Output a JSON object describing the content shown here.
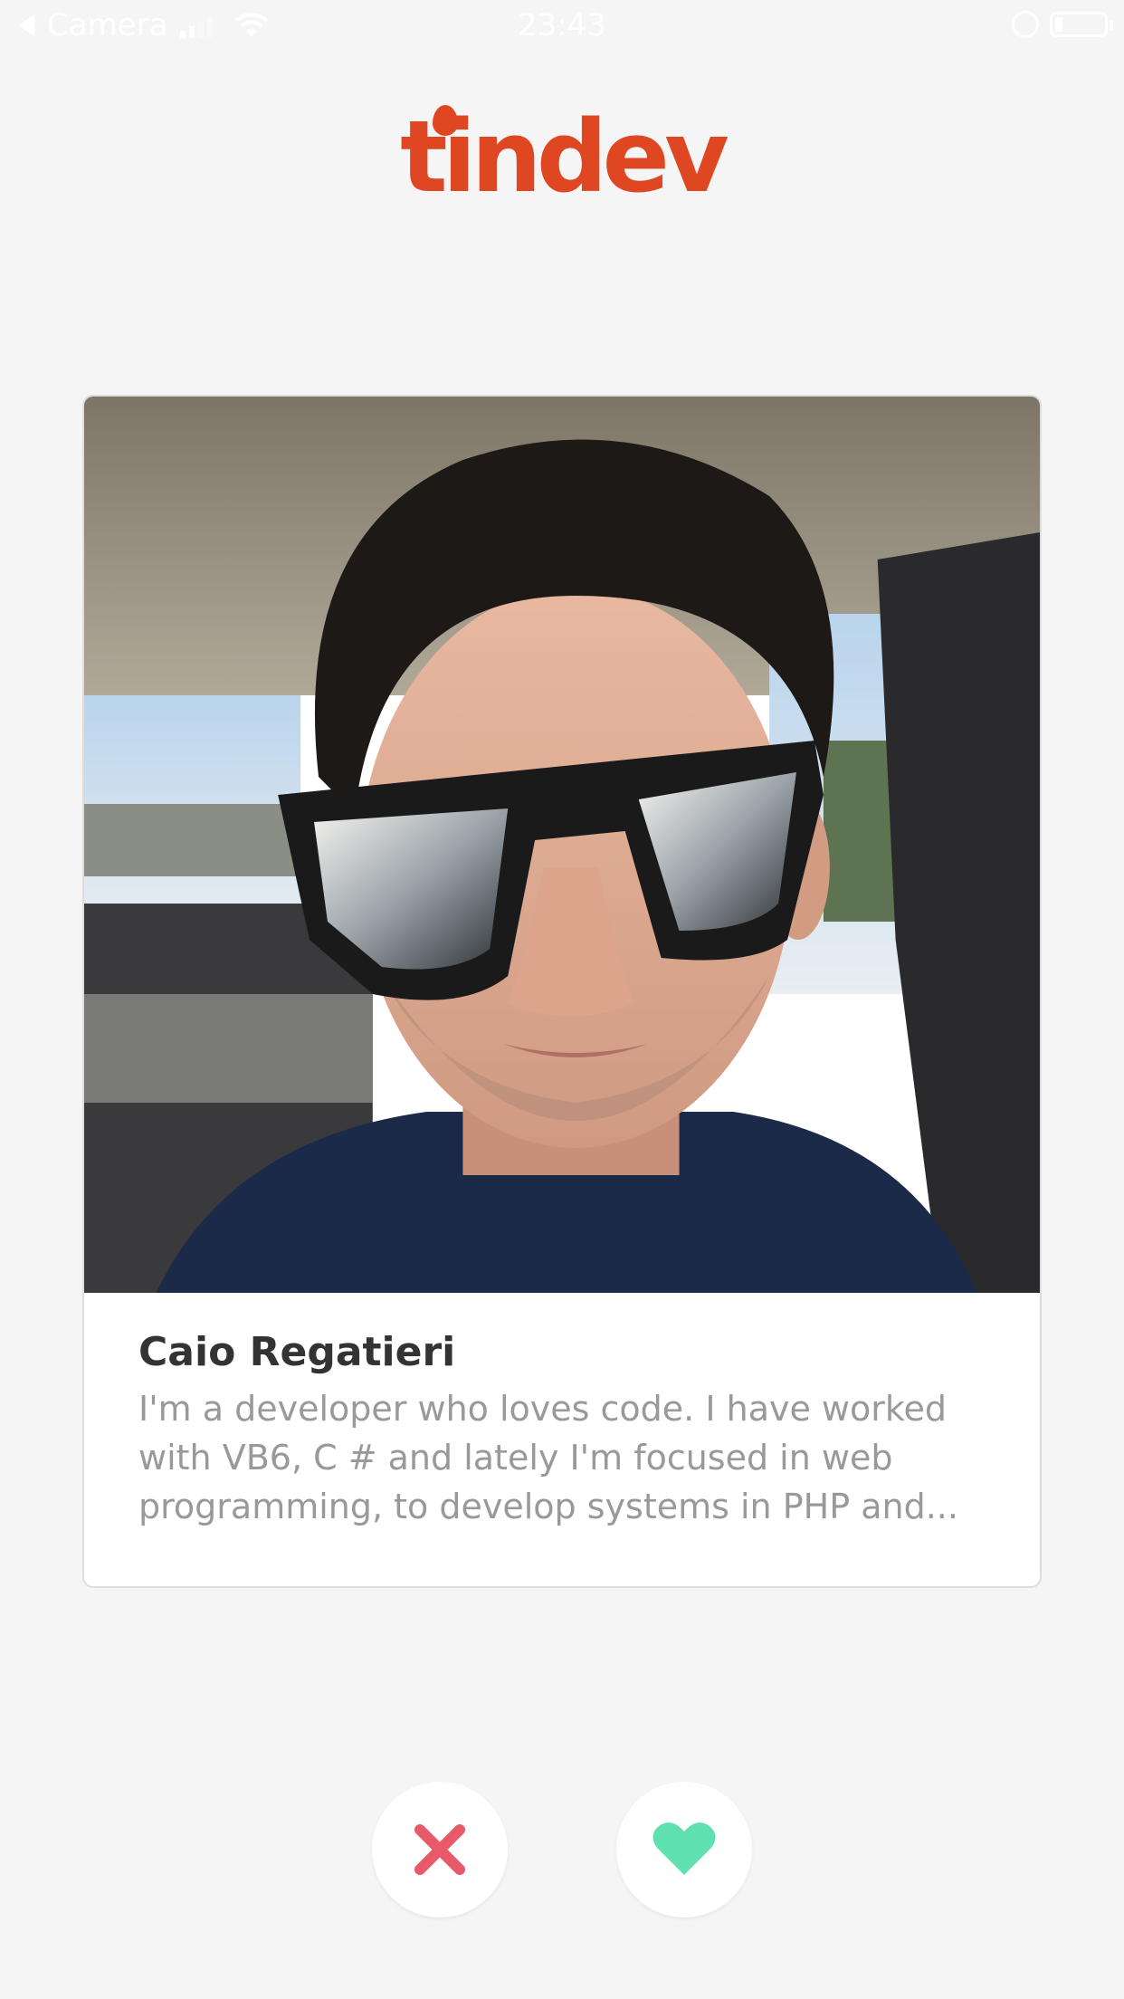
{
  "status_bar": {
    "carrier": "Camera",
    "time": "23:43"
  },
  "header": {
    "logo_text": "tindev"
  },
  "card": {
    "name": "Caio Regatieri",
    "bio": "I'm a developer who loves code. I have worked with VB6, C # and lately I'm focused in web programming, to develop systems in PHP and..."
  },
  "actions": {
    "dislike_icon": "close-icon",
    "like_icon": "heart-icon"
  },
  "colors": {
    "brand": "#df4723",
    "dislike": "#e85a6a",
    "like": "#5ee0b0",
    "background": "#f5f5f5"
  }
}
